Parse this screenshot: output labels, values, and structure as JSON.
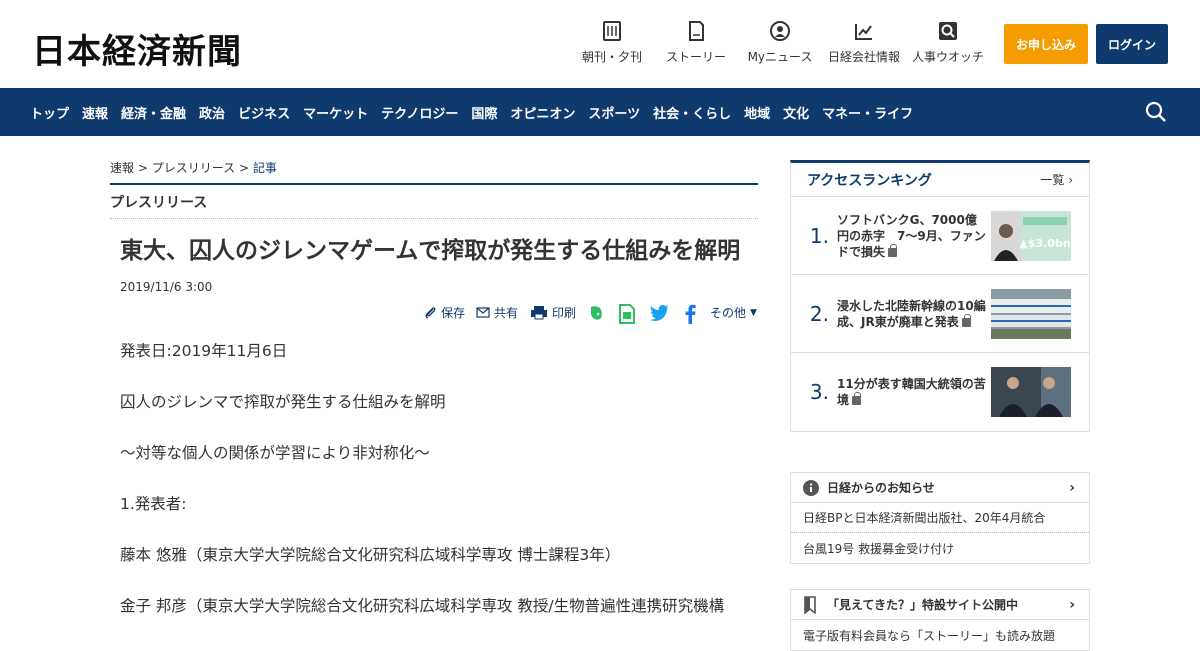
{
  "header": {
    "logo": "日本経済新聞",
    "nav": [
      {
        "label": "朝刊・夕刊",
        "icon": "newspaper-icon"
      },
      {
        "label": "ストーリー",
        "icon": "book-icon"
      },
      {
        "label": "Myニュース",
        "icon": "person-icon"
      },
      {
        "label": "日経会社情報",
        "icon": "chart-icon"
      },
      {
        "label": "人事ウオッチ",
        "icon": "search-person-icon"
      }
    ],
    "subscribe": "お申し込み",
    "login": "ログイン"
  },
  "global_nav": [
    "トップ",
    "速報",
    "経済・金融",
    "政治",
    "ビジネス",
    "マーケット",
    "テクノロジー",
    "国際",
    "オピニオン",
    "スポーツ",
    "社会・くらし",
    "地域",
    "文化",
    "マネー・ライフ"
  ],
  "breadcrumb": {
    "a": "速報",
    "sep": ">",
    "b": "プレスリリース",
    "c": "記事"
  },
  "section": "プレスリリース",
  "article": {
    "title": "東大、囚人のジレンマゲームで搾取が発生する仕組みを解明",
    "date": "2019/11/6 3:00",
    "tools": {
      "save": "保存",
      "share": "共有",
      "print": "印刷",
      "more": "その他"
    },
    "paragraphs": [
      "発表日:2019年11月6日",
      "囚人のジレンマで搾取が発生する仕組みを解明",
      "～対等な個人の関係が学習により非対称化～",
      "1.発表者:",
      "藤本 悠雅（東京大学大学院総合文化研究科広域科学専攻 博士課程3年）",
      "金子 邦彦（東京大学大学院総合文化研究科広域科学専攻 教授/生物普遍性連携研究機構"
    ]
  },
  "ranking": {
    "title": "アクセスランキング",
    "more": "一覧",
    "items": [
      {
        "num": "1.",
        "text": "ソフトバンクG、7000億円の赤字　7～9月、ファンドで損失",
        "thumb_text": "▲$3.0bn"
      },
      {
        "num": "2.",
        "text": "浸水した北陸新幹線の10編成、JR東が廃車と発表",
        "thumb_text": ""
      },
      {
        "num": "3.",
        "text": "11分が表す韓国大統領の苦境",
        "thumb_text": ""
      }
    ]
  },
  "notices": {
    "title": "日経からのお知らせ",
    "rows": [
      "日経BPと日本経済新聞出版社、20年4月統合",
      "台風19号 救援募金受け付け"
    ]
  },
  "special": {
    "title": "「見えてきた？」特設サイト公開中",
    "rows": [
      "電子版有料会員なら「ストーリー」も読み放題"
    ]
  },
  "colors": {
    "navy": "#0f3a6e",
    "orange": "#f59c00"
  }
}
